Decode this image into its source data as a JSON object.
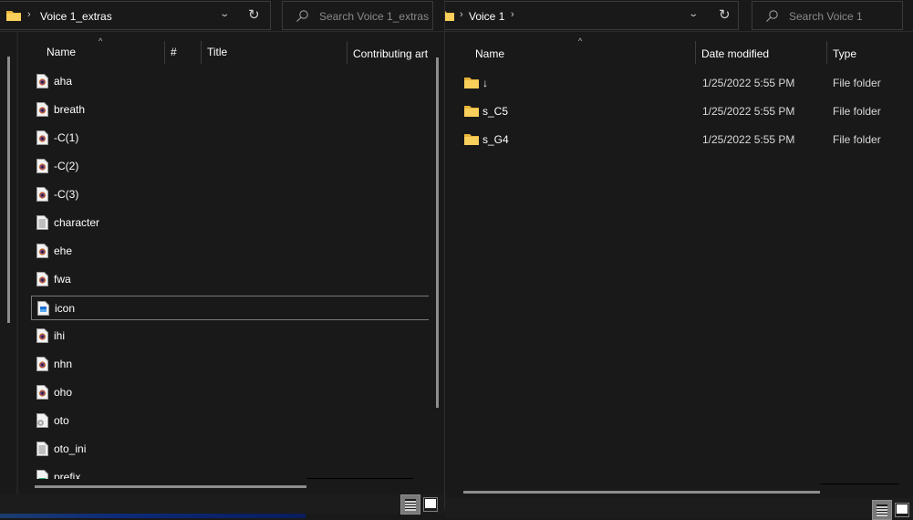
{
  "left_window": {
    "address": {
      "path": "Voice 1_extras",
      "folder_icon": "folder-icon",
      "chevron_icon": "chevron-right-icon",
      "dropdown_icon": "chevron-down-icon",
      "dropdown_glyph": "⌄",
      "refresh_icon": "refresh-icon",
      "refresh_glyph": "↻",
      "chevron_glyph": "›"
    },
    "search": {
      "placeholder": "Search Voice 1_extras",
      "icon": "search-icon"
    },
    "columns": [
      {
        "label": "Name"
      },
      {
        "label": "#"
      },
      {
        "label": "Title"
      },
      {
        "label": "Contributing art"
      }
    ],
    "sort_glyph": "^",
    "files": [
      {
        "name": "aha",
        "icon": "audio-file-icon"
      },
      {
        "name": "breath",
        "icon": "audio-file-icon"
      },
      {
        "name": "-C(1)",
        "icon": "audio-file-icon"
      },
      {
        "name": "-C(2)",
        "icon": "audio-file-icon"
      },
      {
        "name": "-C(3)",
        "icon": "audio-file-icon"
      },
      {
        "name": "character",
        "icon": "text-file-icon"
      },
      {
        "name": "ehe",
        "icon": "audio-file-icon"
      },
      {
        "name": "fwa",
        "icon": "audio-file-icon"
      },
      {
        "name": "icon",
        "icon": "image-file-icon",
        "selected": true
      },
      {
        "name": "ihi",
        "icon": "audio-file-icon"
      },
      {
        "name": "nhn",
        "icon": "audio-file-icon"
      },
      {
        "name": "oho",
        "icon": "audio-file-icon"
      },
      {
        "name": "oto",
        "icon": "settings-file-icon"
      },
      {
        "name": "oto_ini",
        "icon": "text-file-icon"
      },
      {
        "name": "prefix",
        "icon": "map-file-icon"
      }
    ],
    "view_buttons": [
      "details-view-icon",
      "tiles-view-icon"
    ]
  },
  "right_window": {
    "address": {
      "path": "Voice 1",
      "chevron_glyph": "›",
      "dropdown_glyph": "⌄",
      "refresh_glyph": "↻"
    },
    "search": {
      "placeholder": "Search Voice 1"
    },
    "columns": [
      {
        "label": "Name"
      },
      {
        "label": "Date modified"
      },
      {
        "label": "Type"
      }
    ],
    "sort_glyph": "^",
    "folders": [
      {
        "name": "↓",
        "date_modified": "1/25/2022 5:55 PM",
        "type": "File folder"
      },
      {
        "name": "s_C5",
        "date_modified": "1/25/2022 5:55 PM",
        "type": "File folder"
      },
      {
        "name": "s_G4",
        "date_modified": "1/25/2022 5:55 PM",
        "type": "File folder"
      }
    ]
  },
  "colors": {
    "background": "#191919",
    "folder_yellow": "#f4c542",
    "border": "#3a3a3a",
    "placeholder_text": "#8a8a8a",
    "scrollbar": "#8d8d8d"
  }
}
